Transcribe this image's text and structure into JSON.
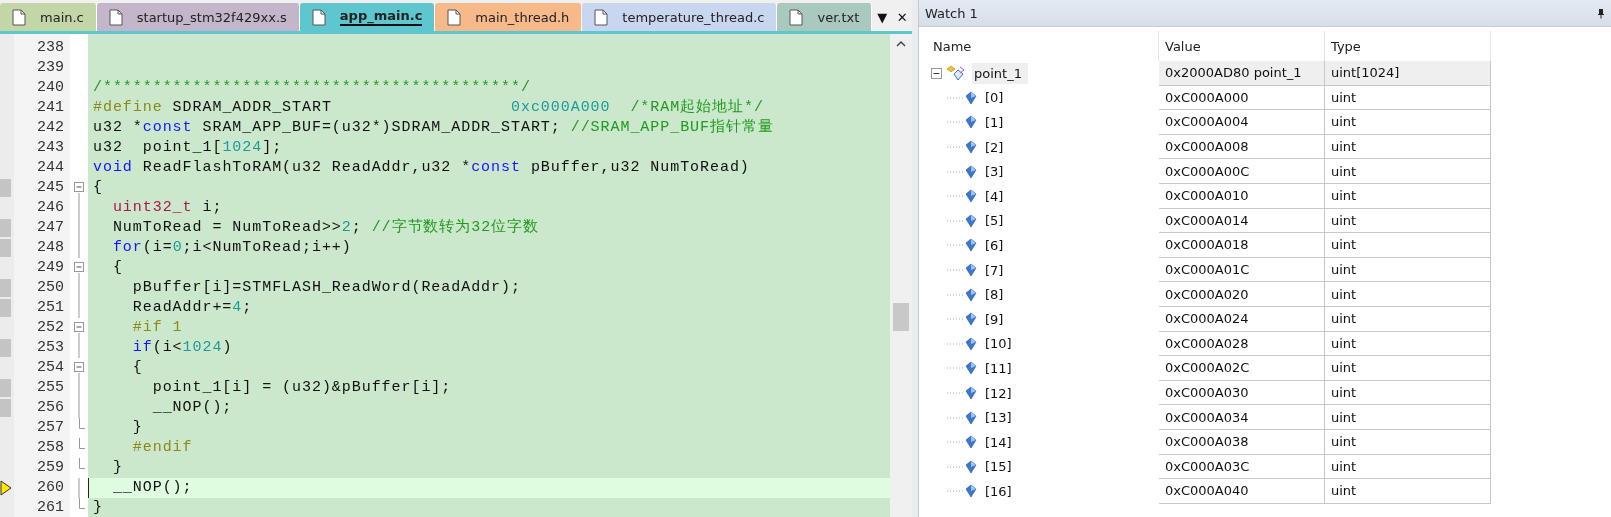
{
  "editor": {
    "tabs": [
      {
        "label": "main.c",
        "selected": false,
        "color": "#c3d6a8"
      },
      {
        "label": "startup_stm32f429xx.s",
        "selected": false,
        "color": "#c3b6cb"
      },
      {
        "label": "app_main.c",
        "selected": true,
        "color": "#5ec6cf"
      },
      {
        "label": "main_thread.h",
        "selected": false,
        "color": "#f8b98a"
      },
      {
        "label": "temperature_thread.c",
        "selected": false,
        "color": "#c9d6f0"
      },
      {
        "label": "ver.txt",
        "selected": false,
        "color": "#a9c9bf"
      }
    ],
    "tab_menu": "▼",
    "tab_close": "✕",
    "lines": [
      {
        "number": "238",
        "executable": false,
        "current": false
      },
      {
        "number": "239",
        "executable": false,
        "current": false
      },
      {
        "number": "240",
        "executable": false,
        "current": false,
        "segments": [
          {
            "kind": "comment",
            "text": "/******************************************/"
          }
        ]
      },
      {
        "number": "241",
        "executable": false,
        "current": false,
        "segments": [
          {
            "kind": "preproc",
            "text": "#define"
          },
          {
            "kind": "plain",
            "text": " SDRAM_ADDR_START                  "
          },
          {
            "kind": "number",
            "text": "0xc000A000"
          },
          {
            "kind": "comment",
            "text": "  /*RAM起始地址*/"
          }
        ]
      },
      {
        "number": "242",
        "executable": false,
        "current": false,
        "segments": [
          {
            "kind": "plain",
            "text": "u32 *"
          },
          {
            "kind": "keyword",
            "text": "const"
          },
          {
            "kind": "plain",
            "text": " SRAM_APP_BUF=(u32*)SDRAM_ADDR_START; "
          },
          {
            "kind": "comment",
            "text": "//SRAM_APP_BUF指针常量"
          }
        ]
      },
      {
        "number": "243",
        "executable": false,
        "current": false,
        "segments": [
          {
            "kind": "plain",
            "text": "u32  point_1["
          },
          {
            "kind": "number",
            "text": "1024"
          },
          {
            "kind": "plain",
            "text": "];"
          }
        ]
      },
      {
        "number": "244",
        "executable": false,
        "current": false,
        "segments": [
          {
            "kind": "keyword",
            "text": "void"
          },
          {
            "kind": "plain",
            "text": " ReadFlashToRAM(u32 ReadAddr,u32 *"
          },
          {
            "kind": "keyword",
            "text": "const"
          },
          {
            "kind": "plain",
            "text": " pBuffer,u32 NumToRead)"
          }
        ]
      },
      {
        "number": "245",
        "executable": true,
        "current": false,
        "kind": "open",
        "segments": [
          {
            "kind": "plain",
            "text": "{"
          }
        ]
      },
      {
        "number": "246",
        "executable": false,
        "current": false,
        "kind": "line",
        "segments": [
          {
            "kind": "type",
            "text": "  uint32_t"
          },
          {
            "kind": "plain",
            "text": " i;"
          }
        ]
      },
      {
        "number": "247",
        "executable": true,
        "current": false,
        "kind": "line",
        "segments": [
          {
            "kind": "plain",
            "text": "  NumToRead = NumToRead>>"
          },
          {
            "kind": "number",
            "text": "2"
          },
          {
            "kind": "plain",
            "text": "; "
          },
          {
            "kind": "comment",
            "text": "//字节数转为32位字数"
          }
        ]
      },
      {
        "number": "248",
        "executable": true,
        "current": false,
        "kind": "line",
        "segments": [
          {
            "kind": "keyword",
            "text": "  for"
          },
          {
            "kind": "plain",
            "text": "(i="
          },
          {
            "kind": "number",
            "text": "0"
          },
          {
            "kind": "plain",
            "text": ";i<NumToRead;i++)"
          }
        ]
      },
      {
        "number": "249",
        "executable": false,
        "current": false,
        "kind": "open",
        "segments": [
          {
            "kind": "plain",
            "text": "  {"
          }
        ]
      },
      {
        "number": "250",
        "executable": true,
        "current": false,
        "kind": "line",
        "segments": [
          {
            "kind": "plain",
            "text": "    pBuffer[i]=STMFLASH_ReadWord(ReadAddr);"
          }
        ]
      },
      {
        "number": "251",
        "executable": true,
        "current": false,
        "kind": "line",
        "segments": [
          {
            "kind": "plain",
            "text": "    ReadAddr+="
          },
          {
            "kind": "number",
            "text": "4"
          },
          {
            "kind": "plain",
            "text": ";"
          }
        ]
      },
      {
        "number": "252",
        "executable": false,
        "current": false,
        "kind": "open",
        "segments": [
          {
            "kind": "preproc",
            "text": "    #if 1"
          }
        ]
      },
      {
        "number": "253",
        "executable": true,
        "current": false,
        "kind": "line",
        "segments": [
          {
            "kind": "keyword",
            "text": "    if"
          },
          {
            "kind": "plain",
            "text": "(i<"
          },
          {
            "kind": "number",
            "text": "1024"
          },
          {
            "kind": "plain",
            "text": ")"
          }
        ]
      },
      {
        "number": "254",
        "executable": false,
        "current": false,
        "kind": "open",
        "segments": [
          {
            "kind": "plain",
            "text": "    {"
          }
        ]
      },
      {
        "number": "255",
        "executable": true,
        "current": false,
        "kind": "line",
        "segments": [
          {
            "kind": "plain",
            "text": "      point_1[i] = (u32)&pBuffer[i];"
          }
        ]
      },
      {
        "number": "256",
        "executable": true,
        "current": false,
        "kind": "line",
        "segments": [
          {
            "kind": "plain",
            "text": "      __NOP();"
          }
        ]
      },
      {
        "number": "257",
        "executable": false,
        "current": false,
        "kind": "end",
        "segments": [
          {
            "kind": "plain",
            "text": "    }"
          }
        ]
      },
      {
        "number": "258",
        "executable": false,
        "current": false,
        "kind": "end",
        "segments": [
          {
            "kind": "preproc",
            "text": "    #endif"
          }
        ]
      },
      {
        "number": "259",
        "executable": false,
        "current": false,
        "kind": "end",
        "segments": [
          {
            "kind": "plain",
            "text": "  }"
          }
        ]
      },
      {
        "number": "260",
        "executable": true,
        "current": true,
        "kind": "line",
        "segments": [
          {
            "kind": "plain",
            "text": "  __NOP();"
          }
        ]
      },
      {
        "number": "261",
        "executable": false,
        "current": false,
        "kind": "end",
        "segments": [
          {
            "kind": "plain",
            "text": "}"
          }
        ]
      }
    ]
  },
  "watch": {
    "title": "Watch 1",
    "columns": [
      "Name",
      "Value",
      "Type"
    ],
    "rows": [
      {
        "name": "point_1",
        "value": "0x2000AD80 point_1",
        "type": "uint[1024]",
        "expanded": true,
        "children": [
          {
            "name": "[0]",
            "value": "0xC000A000",
            "type": "uint"
          },
          {
            "name": "[1]",
            "value": "0xC000A004",
            "type": "uint"
          },
          {
            "name": "[2]",
            "value": "0xC000A008",
            "type": "uint"
          },
          {
            "name": "[3]",
            "value": "0xC000A00C",
            "type": "uint"
          },
          {
            "name": "[4]",
            "value": "0xC000A010",
            "type": "uint"
          },
          {
            "name": "[5]",
            "value": "0xC000A014",
            "type": "uint"
          },
          {
            "name": "[6]",
            "value": "0xC000A018",
            "type": "uint"
          },
          {
            "name": "[7]",
            "value": "0xC000A01C",
            "type": "uint"
          },
          {
            "name": "[8]",
            "value": "0xC000A020",
            "type": "uint"
          },
          {
            "name": "[9]",
            "value": "0xC000A024",
            "type": "uint"
          },
          {
            "name": "[10]",
            "value": "0xC000A028",
            "type": "uint"
          },
          {
            "name": "[11]",
            "value": "0xC000A02C",
            "type": "uint"
          },
          {
            "name": "[12]",
            "value": "0xC000A030",
            "type": "uint"
          },
          {
            "name": "[13]",
            "value": "0xC000A034",
            "type": "uint"
          },
          {
            "name": "[14]",
            "value": "0xC000A038",
            "type": "uint"
          },
          {
            "name": "[15]",
            "value": "0xC000A03C",
            "type": "uint"
          },
          {
            "name": "[16]",
            "value": "0xC000A040",
            "type": "uint"
          }
        ]
      }
    ]
  }
}
